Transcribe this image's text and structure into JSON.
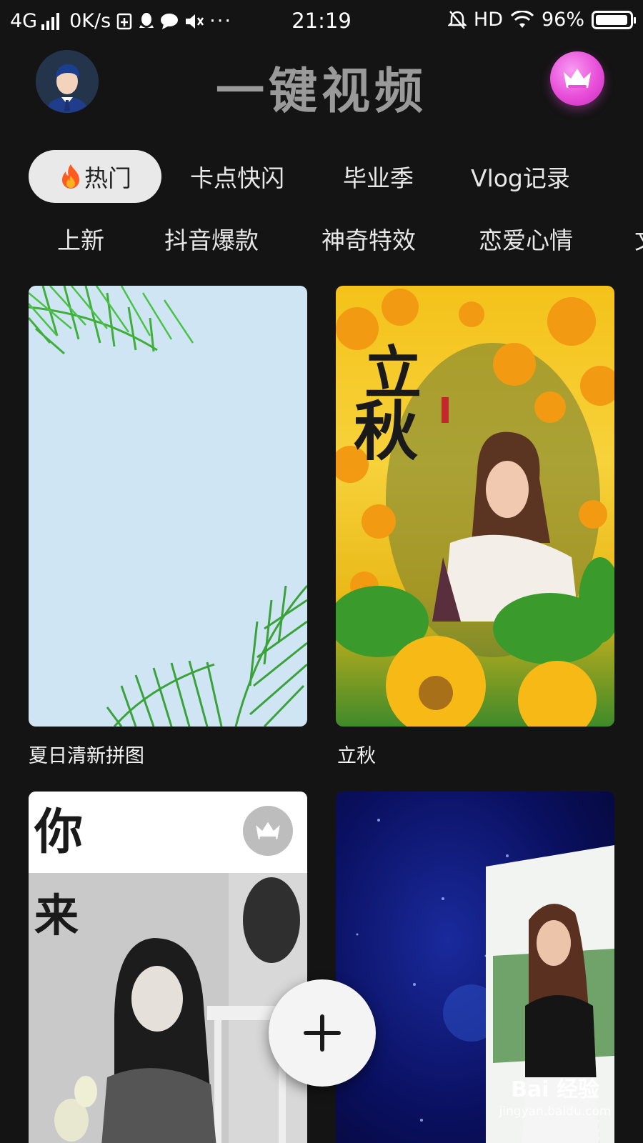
{
  "status_bar": {
    "network": "4G",
    "speed": "0K/s",
    "time": "21:19",
    "hd": "HD",
    "battery": "96%",
    "battery_level": 0.96
  },
  "header": {
    "title": "一键视频"
  },
  "tabs_primary": [
    {
      "label": "热门",
      "active": true
    },
    {
      "label": "卡点快闪",
      "active": false
    },
    {
      "label": "毕业季",
      "active": false
    },
    {
      "label": "Vlog记录",
      "active": false
    }
  ],
  "tabs_secondary": [
    {
      "label": "上新"
    },
    {
      "label": "抖音爆款"
    },
    {
      "label": "神奇特效"
    },
    {
      "label": "恋爱心情"
    },
    {
      "label": "文"
    }
  ],
  "templates": [
    {
      "title": "夏日清新拼图",
      "vip": false
    },
    {
      "title": "立秋",
      "vip": false,
      "overlay_text": "立秋"
    },
    {
      "title": "",
      "vip": true,
      "overlay_text_1": "你",
      "overlay_text_2": "来"
    },
    {
      "title": "",
      "vip": false
    }
  ],
  "watermark": {
    "brand": "Bai 经验",
    "url": "jingyan.baidu.com"
  },
  "colors": {
    "background": "#141414",
    "vip_accent": "#e84ed9",
    "active_tab_bg": "#e9e9e9"
  }
}
